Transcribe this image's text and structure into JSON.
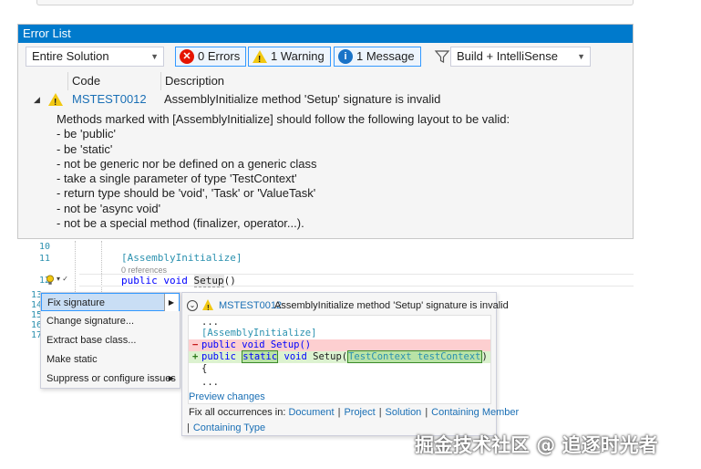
{
  "error_list": {
    "title": "Error List",
    "scope_combo": "Entire Solution",
    "errors_filter": "0 Errors",
    "warnings_filter": "1 Warning",
    "messages_filter": "1 Message",
    "build_combo": "Build + IntelliSense",
    "columns": [
      "Code",
      "Description"
    ],
    "row": {
      "code": "MSTEST0012",
      "description": "AssemblyInitialize method 'Setup' signature is invalid"
    },
    "details": [
      "Methods marked with [AssemblyInitialize] should follow the following layout to be valid:",
      "- be 'public'",
      "- be 'static'",
      "- not be generic nor be defined on a generic class",
      "- take a single parameter of type 'TestContext'",
      "- return type should be 'void', 'Task' or 'ValueTask'",
      "- not be 'async void'",
      "- not be a special method (finalizer, operator...)."
    ]
  },
  "editor": {
    "line_numbers": [
      "10",
      "11",
      "12",
      "13",
      "14",
      "15",
      "16",
      "17"
    ],
    "attribute_line": "[AssemblyInitialize]",
    "references": "0 references",
    "kw_public": "public",
    "kw_void": "void",
    "method_name": "Setup",
    "parens": "()"
  },
  "quick_actions": {
    "items": [
      "Fix signature",
      "Change signature...",
      "Extract base class...",
      "Make static",
      "Suppress or configure issues"
    ]
  },
  "preview": {
    "code": "MSTEST0012",
    "description": "AssemblyInitialize method 'Setup' signature is invalid",
    "ellipsis": "...",
    "attribute": "[AssemblyInitialize]",
    "removed_line": "public void Setup()",
    "added_public": "public",
    "added_static": "static",
    "added_void": "void",
    "added_name": "Setup(",
    "added_param": "TestContext testContext",
    "added_close": ")",
    "brace": "{",
    "preview_changes": "Preview changes",
    "fix_all_label": "Fix all occurrences in:",
    "fix_targets": [
      "Document",
      "Project",
      "Solution",
      "Containing Member",
      "Containing Type"
    ]
  },
  "watermark": "掘金技术社区 @ 追逐时光者",
  "colors": {
    "accent": "#007acc",
    "link": "#1a6fb5",
    "keyword": "#0000ff",
    "type": "#2b91af",
    "warning": "#f2c811",
    "error": "#e51400",
    "removed_bg": "#fdcfd0",
    "added_bg": "#dcf2d0"
  }
}
